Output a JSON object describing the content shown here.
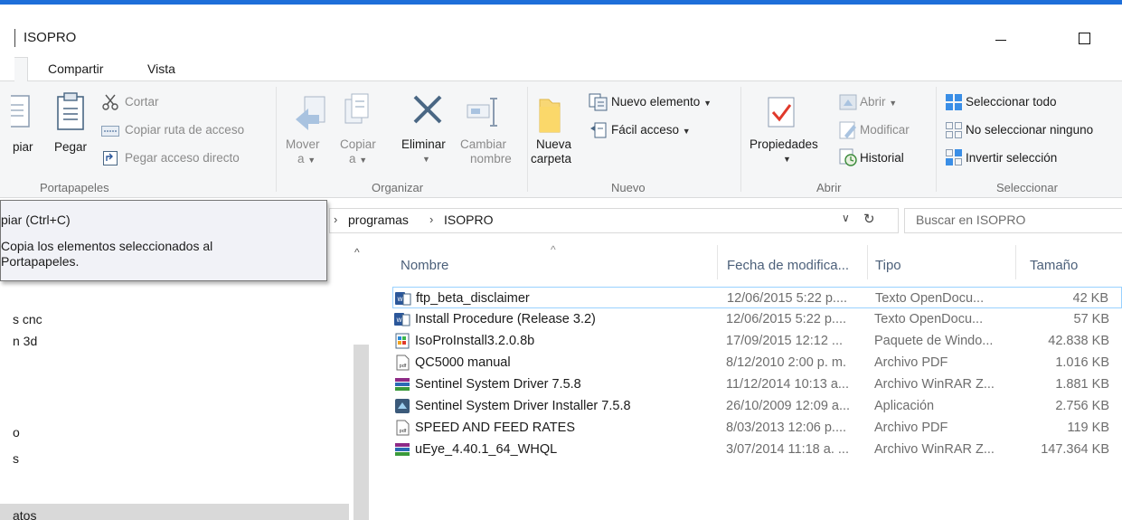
{
  "window": {
    "title": "ISOPRO"
  },
  "tabs": [
    "Compartir",
    "Vista"
  ],
  "ribbon": {
    "portapapeles": {
      "label": "Portapapeles",
      "copiar": "piar",
      "pegar": "Pegar",
      "cortar": "Cortar",
      "copiar_ruta": "Copiar ruta de acceso",
      "pegar_acceso": "Pegar acceso directo"
    },
    "organizar": {
      "label": "Organizar",
      "mover_line1": "Mover",
      "mover_line2": "a",
      "copiar_line1": "Copiar",
      "copiar_line2": "a",
      "eliminar": "Eliminar",
      "cambiar_line1": "Cambiar",
      "cambiar_line2": "nombre"
    },
    "nuevo": {
      "label": "Nuevo",
      "carpeta_line1": "Nueva",
      "carpeta_line2": "carpeta",
      "nuevo_elemento": "Nuevo elemento",
      "facil_acceso": "Fácil acceso"
    },
    "abrir": {
      "label": "Abrir",
      "propiedades": "Propiedades",
      "abrir": "Abrir",
      "modificar": "Modificar",
      "historial": "Historial"
    },
    "seleccionar": {
      "label": "Seleccionar",
      "todo": "Seleccionar todo",
      "ninguno": "No seleccionar ninguno",
      "invertir": "Invertir selección"
    }
  },
  "address": {
    "crumbs": [
      "programas",
      "ISOPRO"
    ],
    "search_placeholder": "Buscar en ISOPRO"
  },
  "tooltip": {
    "title": "piar (Ctrl+C)",
    "body_line1": "Copia los elementos seleccionados al",
    "body_line2": "Portapapeles."
  },
  "nav_items": [
    "s cnc",
    "n 3d",
    "o",
    "s",
    "atos"
  ],
  "columns": {
    "name": "Nombre",
    "date": "Fecha de modifica...",
    "type": "Tipo",
    "size": "Tamaño"
  },
  "files": [
    {
      "name": "ftp_beta_disclaimer",
      "date": "12/06/2015 5:22 p....",
      "type": "Texto OpenDocu...",
      "size": "42 KB",
      "icon": "odt-doc-icon"
    },
    {
      "name": "Install Procedure (Release 3.2)",
      "date": "12/06/2015 5:22 p....",
      "type": "Texto OpenDocu...",
      "size": "57 KB",
      "icon": "odt-doc-icon"
    },
    {
      "name": "IsoProInstall3.2.0.8b",
      "date": "17/09/2015 12:12 ...",
      "type": "Paquete de Windo...",
      "size": "42.838 KB",
      "icon": "msi-package-icon"
    },
    {
      "name": "QC5000 manual",
      "date": "8/12/2010 2:00 p. m.",
      "type": "Archivo PDF",
      "size": "1.016 KB",
      "icon": "pdf-file-icon"
    },
    {
      "name": "Sentinel System Driver 7.5.8",
      "date": "11/12/2014 10:13 a...",
      "type": "Archivo WinRAR Z...",
      "size": "1.881 KB",
      "icon": "winrar-archive-icon"
    },
    {
      "name": "Sentinel System Driver Installer 7.5.8",
      "date": "26/10/2009 12:09 a...",
      "type": "Aplicación",
      "size": "2.756 KB",
      "icon": "installer-app-icon"
    },
    {
      "name": "SPEED AND FEED RATES",
      "date": "8/03/2013 12:06 p....",
      "type": "Archivo PDF",
      "size": "119 KB",
      "icon": "pdf-file-icon"
    },
    {
      "name": "uEye_4.40.1_64_WHQL",
      "date": "3/07/2014 11:18 a. ...",
      "type": "Archivo WinRAR Z...",
      "size": "147.364 KB",
      "icon": "winrar-archive-icon"
    }
  ],
  "colors": {
    "accent": "#1e6fd9",
    "selection_border": "#99d1ff",
    "ribbon_bg": "#f5f6f7"
  }
}
